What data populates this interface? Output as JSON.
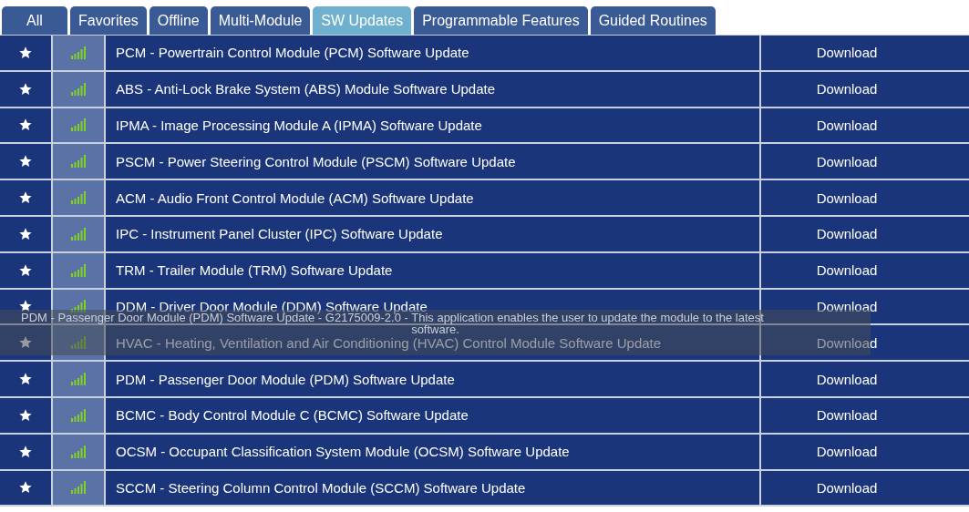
{
  "tabs": [
    {
      "label": "All",
      "selected": false
    },
    {
      "label": "Favorites",
      "selected": false
    },
    {
      "label": "Offline",
      "selected": false
    },
    {
      "label": "Multi-Module",
      "selected": false
    },
    {
      "label": "SW Updates",
      "selected": true
    },
    {
      "label": "Programmable Features",
      "selected": false
    },
    {
      "label": "Guided Routines",
      "selected": false
    }
  ],
  "rows": [
    {
      "name": "PCM - Powertrain Control Module (PCM) Software Update",
      "action": "Download"
    },
    {
      "name": "ABS - Anti-Lock Brake System (ABS) Module Software Update",
      "action": "Download"
    },
    {
      "name": "IPMA - Image Processing Module A (IPMA) Software Update",
      "action": "Download"
    },
    {
      "name": "PSCM - Power Steering Control Module (PSCM) Software Update",
      "action": "Download"
    },
    {
      "name": "ACM - Audio Front Control Module (ACM) Software Update",
      "action": "Download"
    },
    {
      "name": "IPC - Instrument Panel Cluster (IPC) Software Update",
      "action": "Download"
    },
    {
      "name": "TRM - Trailer Module (TRM) Software Update",
      "action": "Download"
    },
    {
      "name": "DDM - Driver Door Module (DDM) Software Update",
      "action": "Download"
    },
    {
      "name": "HVAC - Heating, Ventilation and Air Conditioning (HVAC) Control Module Software Update",
      "action": "Download"
    },
    {
      "name": "PDM - Passenger Door Module (PDM) Software Update",
      "action": "Download"
    },
    {
      "name": "BCMC - Body Control Module C (BCMC) Software Update",
      "action": "Download"
    },
    {
      "name": "OCSM - Occupant Classification System Module (OCSM) Software Update",
      "action": "Download"
    },
    {
      "name": "SCCM - Steering Column Control Module (SCCM) Software Update",
      "action": "Download"
    }
  ],
  "tooltip": {
    "lines": [
      "PDM - Passenger Door Module (PDM) Software Update - G2175009-2.0 - This application enables the user to update the module to the latest",
      "software."
    ]
  }
}
